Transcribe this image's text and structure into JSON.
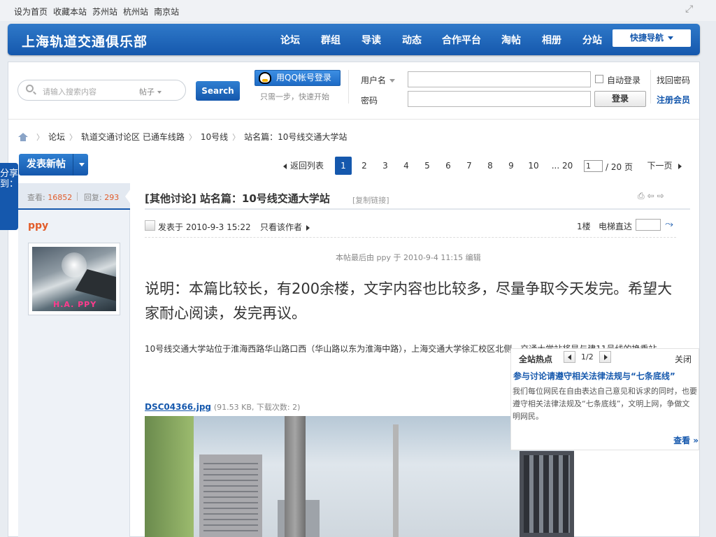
{
  "topbar": {
    "links": [
      "设为首页",
      "收藏本站",
      "苏州站",
      "杭州站",
      "南京站"
    ]
  },
  "header": {
    "site_title": "上海轨道交通俱乐部",
    "nav": [
      "论坛",
      "群组",
      "导读",
      "动态",
      "合作平台",
      "淘帖",
      "相册",
      "分站"
    ],
    "quick_nav": "快捷导航"
  },
  "search": {
    "placeholder": "请输入搜索内容",
    "type": "帖子",
    "button": "Search"
  },
  "qq_login": {
    "button": "用QQ帐号登录",
    "tip": "只需一步，快速开始"
  },
  "login": {
    "username_label": "用户名",
    "password_label": "密码",
    "auto_login": "自动登录",
    "login_button": "登录",
    "forgot": "找回密码",
    "register": "注册会员"
  },
  "breadcrumb": [
    "论坛",
    "轨道交通讨论区 已通车线路",
    "10号线",
    "站名篇：10号线交通大学站"
  ],
  "new_post": "发表新帖",
  "share_tab": "分享到：",
  "pager": {
    "back": "返回列表",
    "pages": [
      "1",
      "2",
      "3",
      "4",
      "5",
      "6",
      "7",
      "8",
      "9",
      "10"
    ],
    "last": "... 20",
    "current_input": "1",
    "total": "/ 20 页",
    "next": "下一页"
  },
  "thread": {
    "views_label": "查看:",
    "views": "16852",
    "replies_label": "回复:",
    "replies": "293",
    "title": "[其他讨论] 站名篇：10号线交通大学站",
    "copy_link": "[复制链接]",
    "author": "ppy",
    "avatar_tag": "H.A. PPY",
    "posted": "发表于 2010-9-3 15:22",
    "only_author": "只看该作者",
    "floor": "1楼",
    "jump_label": "电梯直达",
    "edited": "本帖最后由 ppy 于 2010-9-4 11:15 编辑",
    "intro": "说明：本篇比较长，有200余楼，文字内容也比较多，尽量争取今天发完。希望大家耐心阅读，发完再议。",
    "body": "10号线交通大学站位于淮海西路华山路口西（华山路以东为淮海中路），上海交通大学徐汇校区北侧，交通大学站将是与建11号线的换乘站，",
    "attachment_name": "DSC04366.jpg",
    "attachment_info": "(91.53 KB, 下载次数: 2)"
  },
  "hot": {
    "title": "全站热点",
    "page": "1/2",
    "close": "关闭",
    "headline": "参与讨论请遵守相关法律法规与“七条底线”",
    "text": "我们每位网民在自由表达自己意见和诉求的同时，也要遵守相关法律法规及“七条底线”，文明上网，争做文明网民。",
    "more": "查看 »"
  }
}
